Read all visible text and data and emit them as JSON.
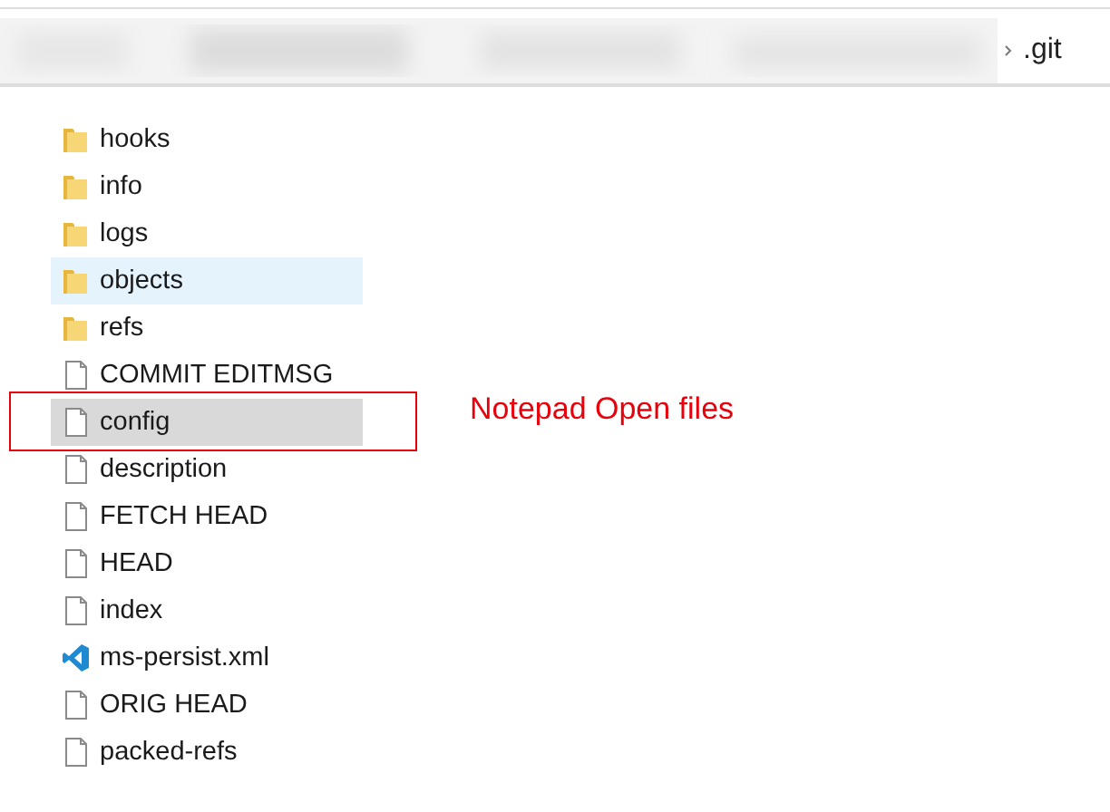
{
  "address_bar": {
    "current_folder": ".git"
  },
  "files": [
    {
      "name": "hooks",
      "kind": "folder",
      "hovered": false,
      "selected": false
    },
    {
      "name": "info",
      "kind": "folder",
      "hovered": false,
      "selected": false
    },
    {
      "name": "logs",
      "kind": "folder",
      "hovered": false,
      "selected": false
    },
    {
      "name": "objects",
      "kind": "folder",
      "hovered": true,
      "selected": false
    },
    {
      "name": "refs",
      "kind": "folder",
      "hovered": false,
      "selected": false
    },
    {
      "name": "COMMIT EDITMSG",
      "kind": "file",
      "hovered": false,
      "selected": false
    },
    {
      "name": "config",
      "kind": "file",
      "hovered": false,
      "selected": true
    },
    {
      "name": "description",
      "kind": "file",
      "hovered": false,
      "selected": false
    },
    {
      "name": "FETCH HEAD",
      "kind": "file",
      "hovered": false,
      "selected": false
    },
    {
      "name": "HEAD",
      "kind": "file",
      "hovered": false,
      "selected": false
    },
    {
      "name": "index",
      "kind": "file",
      "hovered": false,
      "selected": false
    },
    {
      "name": "ms-persist.xml",
      "kind": "vscode",
      "hovered": false,
      "selected": false
    },
    {
      "name": "ORIG HEAD",
      "kind": "file",
      "hovered": false,
      "selected": false
    },
    {
      "name": "packed-refs",
      "kind": "file",
      "hovered": false,
      "selected": false
    }
  ],
  "annotation": {
    "text": "Notepad Open files"
  }
}
